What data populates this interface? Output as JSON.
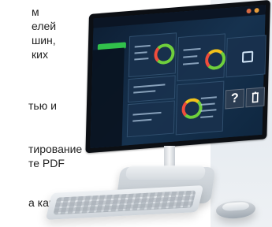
{
  "left_text": {
    "line_1": "м",
    "line_2": "елей",
    "line_3": "шин,",
    "line_4": "ких",
    "line_5": "тью и",
    "line_6": "тирование",
    "line_7": "те PDF",
    "line_8": "а как"
  },
  "screen": {
    "tile_help_symbol": "?",
    "tile_trash_icon": "trash-icon"
  }
}
